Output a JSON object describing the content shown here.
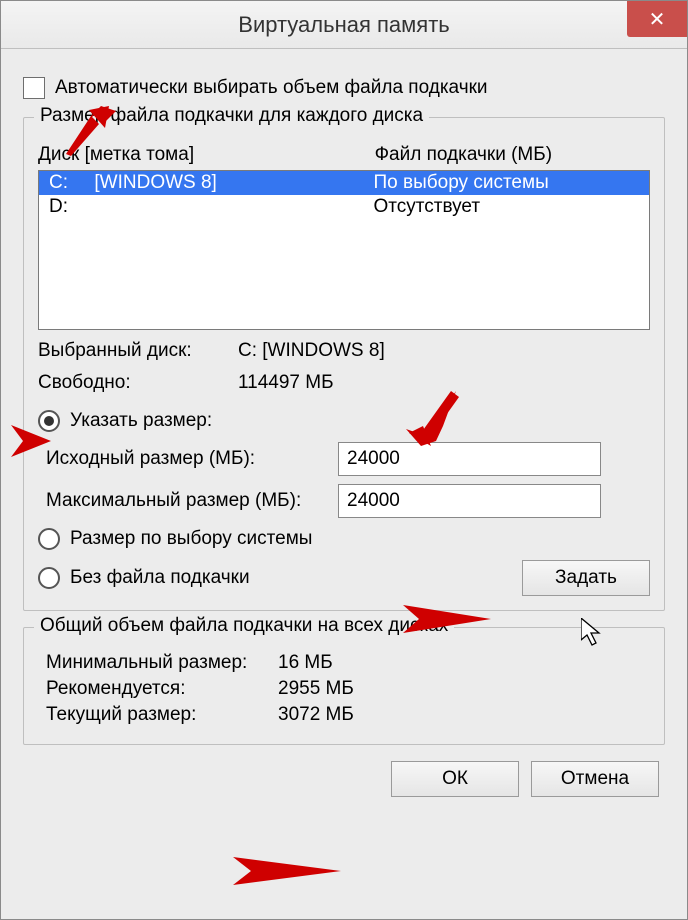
{
  "window": {
    "title": "Виртуальная память"
  },
  "auto_checkbox": {
    "label": "Автоматически выбирать объем файла подкачки",
    "checked": false
  },
  "drives_group": {
    "legend": "Размер файла подкачки для каждого диска",
    "col_drive": "Диск [метка тома]",
    "col_file": "Файл подкачки (МБ)",
    "rows": [
      {
        "drive": "C:     [WINDOWS 8]",
        "file": "По выбору системы",
        "selected": true
      },
      {
        "drive": "D:",
        "file": "Отсутствует",
        "selected": false
      }
    ],
    "selected_drive_label": "Выбранный диск:",
    "selected_drive_value": "C:  [WINDOWS 8]",
    "free_label": "Свободно:",
    "free_value": "114497 МБ",
    "radio_custom": "Указать размер:",
    "initial_label": "Исходный размер (МБ):",
    "initial_value": "24000",
    "max_label": "Максимальный размер (МБ):",
    "max_value": "24000",
    "radio_system": "Размер по выбору системы",
    "radio_none": "Без файла подкачки",
    "set_button": "Задать"
  },
  "totals_group": {
    "legend": "Общий объем файла подкачки на всех дисках",
    "min_label": "Минимальный размер:",
    "min_value": "16 МБ",
    "rec_label": "Рекомендуется:",
    "rec_value": "2955 МБ",
    "cur_label": "Текущий размер:",
    "cur_value": "3072 МБ"
  },
  "buttons": {
    "ok": "ОК",
    "cancel": "Отмена"
  }
}
